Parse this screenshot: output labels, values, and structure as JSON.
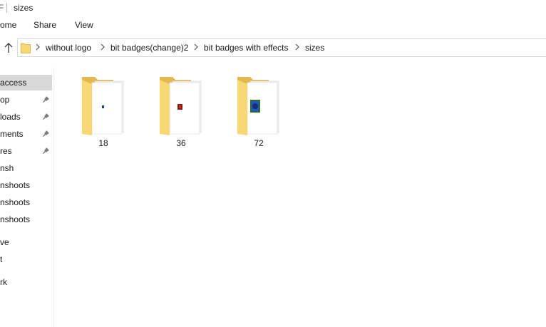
{
  "window": {
    "title_glyph": "F",
    "title": "sizes"
  },
  "ribbon": {
    "tabs": [
      "ome",
      "Share",
      "View"
    ]
  },
  "address": {
    "breadcrumbs": [
      "without logo",
      "bit badges(change)2",
      "bit badges with effects",
      "sizes"
    ]
  },
  "nav": {
    "items": [
      {
        "label": "access",
        "pinned": false,
        "selected": true
      },
      {
        "label": "op",
        "pinned": true,
        "selected": false
      },
      {
        "label": "loads",
        "pinned": true,
        "selected": false
      },
      {
        "label": "ments",
        "pinned": true,
        "selected": false
      },
      {
        "label": "res",
        "pinned": true,
        "selected": false
      },
      {
        "label": "nsh",
        "pinned": false,
        "selected": false
      },
      {
        "label": "nshoots",
        "pinned": false,
        "selected": false
      },
      {
        "label": "nshoots",
        "pinned": false,
        "selected": false
      },
      {
        "label": "nshoots",
        "pinned": false,
        "selected": false
      },
      {
        "label": "ve",
        "pinned": false,
        "selected": false
      },
      {
        "label": "t",
        "pinned": false,
        "selected": false
      },
      {
        "label": "rk",
        "pinned": false,
        "selected": false
      }
    ]
  },
  "folders": [
    {
      "name": "18",
      "thumbnail": "tiny-blue-badge"
    },
    {
      "name": "36",
      "thumbnail": "small-red-badge"
    },
    {
      "name": "72",
      "thumbnail": "blue-green-badge"
    }
  ],
  "colors": {
    "folder_back": "#e3b84f",
    "folder_front": "#f8d775",
    "selected_nav": "#d9d9d9",
    "border": "#d9d9d9"
  }
}
